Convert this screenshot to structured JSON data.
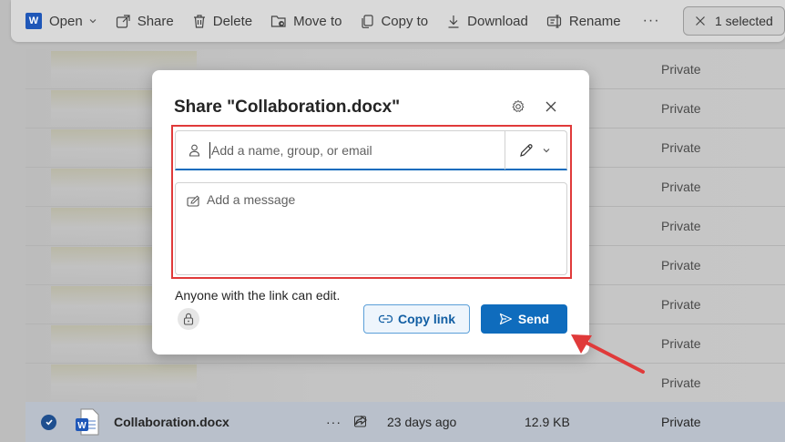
{
  "toolbar": {
    "open": "Open",
    "share": "Share",
    "delete": "Delete",
    "move_to": "Move to",
    "copy_to": "Copy to",
    "download": "Download",
    "rename": "Rename",
    "more": "···",
    "selected": "1 selected"
  },
  "list": {
    "rows_access": [
      "Private",
      "Private",
      "Private",
      "Private",
      "Private",
      "Private",
      "Private",
      "Private",
      "Private"
    ],
    "selected_file": {
      "name": "Collaboration.docx",
      "more": "···",
      "modified": "23 days ago",
      "size": "12.9 KB",
      "access": "Private"
    }
  },
  "dialog": {
    "title": "Share \"Collaboration.docx\"",
    "recipient_placeholder": "Add a name, group, or email",
    "message_placeholder": "Add a message",
    "link_note": "Anyone with the link can edit.",
    "copy_link": "Copy link",
    "send": "Send"
  },
  "colors": {
    "accent": "#0f6cbd",
    "highlight": "#e03a3a"
  }
}
